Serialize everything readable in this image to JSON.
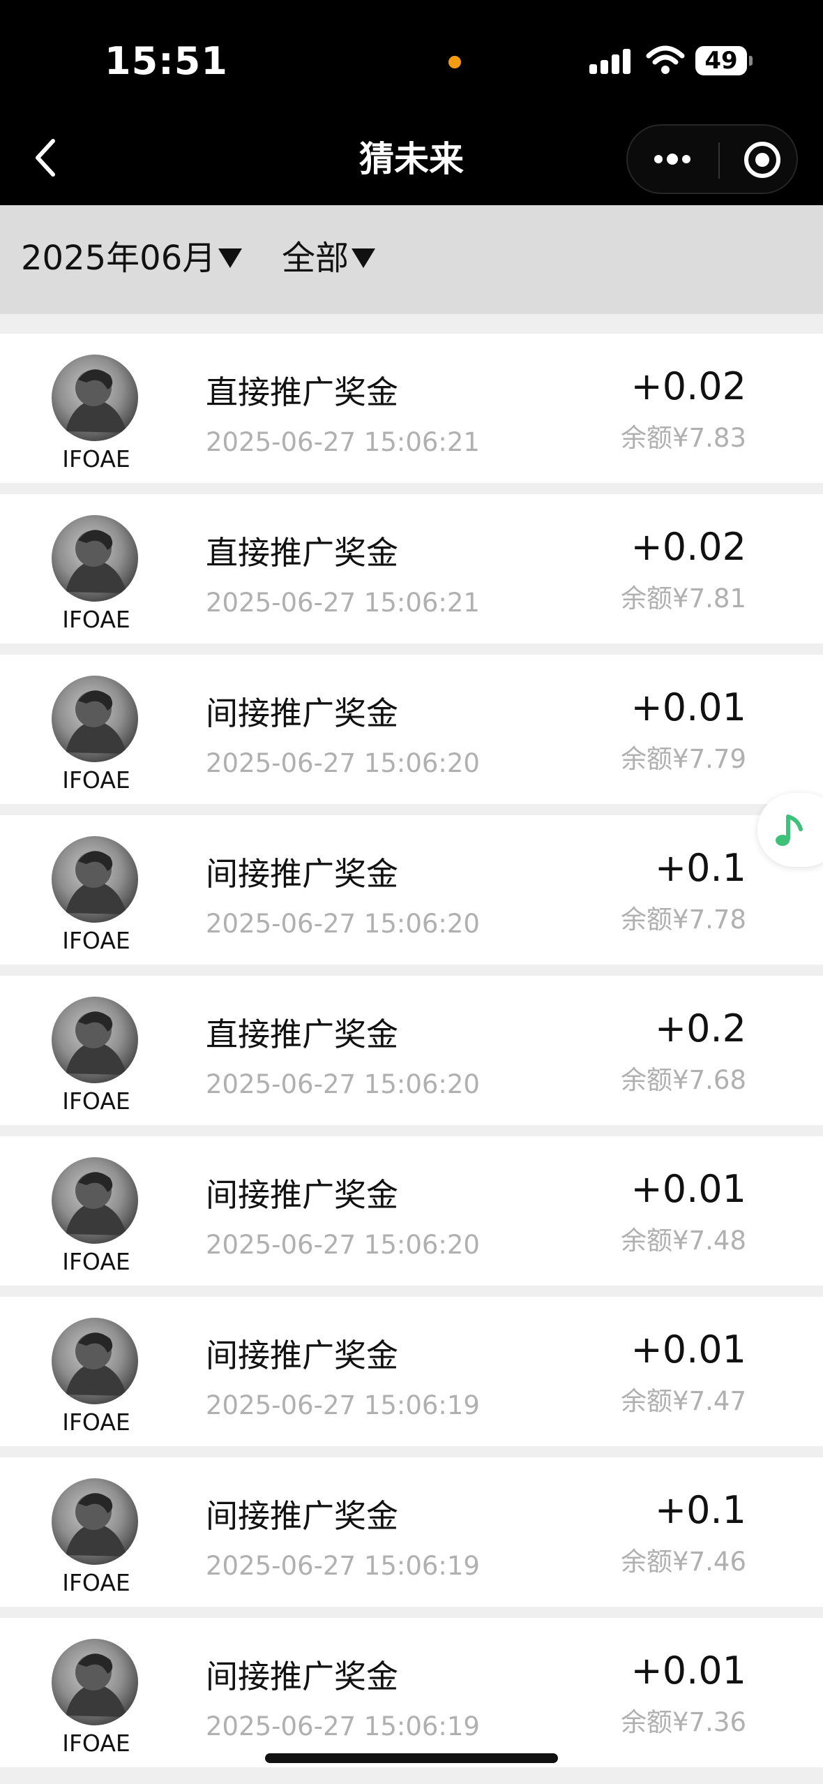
{
  "status_bar": {
    "time": "15:51",
    "battery": "49"
  },
  "nav": {
    "title": "猜未来",
    "icons": [
      "back-icon",
      "more-icon",
      "target-icon"
    ]
  },
  "filters": {
    "month": "2025年06月",
    "category": "全部"
  },
  "records": [
    {
      "user": "IFOAE",
      "title": "直接推广奖金",
      "time": "2025-06-27 15:06:21",
      "amount": "+0.02",
      "balance": "余额¥7.83"
    },
    {
      "user": "IFOAE",
      "title": "直接推广奖金",
      "time": "2025-06-27 15:06:21",
      "amount": "+0.02",
      "balance": "余额¥7.81"
    },
    {
      "user": "IFOAE",
      "title": "间接推广奖金",
      "time": "2025-06-27 15:06:20",
      "amount": "+0.01",
      "balance": "余额¥7.79"
    },
    {
      "user": "IFOAE",
      "title": "间接推广奖金",
      "time": "2025-06-27 15:06:20",
      "amount": "+0.1",
      "balance": "余额¥7.78"
    },
    {
      "user": "IFOAE",
      "title": "直接推广奖金",
      "time": "2025-06-27 15:06:20",
      "amount": "+0.2",
      "balance": "余额¥7.68"
    },
    {
      "user": "IFOAE",
      "title": "间接推广奖金",
      "time": "2025-06-27 15:06:20",
      "amount": "+0.01",
      "balance": "余额¥7.48"
    },
    {
      "user": "IFOAE",
      "title": "间接推广奖金",
      "time": "2025-06-27 15:06:19",
      "amount": "+0.01",
      "balance": "余额¥7.47"
    },
    {
      "user": "IFOAE",
      "title": "间接推广奖金",
      "time": "2025-06-27 15:06:19",
      "amount": "+0.1",
      "balance": "余额¥7.46"
    },
    {
      "user": "IFOAE",
      "title": "间接推广奖金",
      "time": "2025-06-27 15:06:19",
      "amount": "+0.01",
      "balance": "余额¥7.36"
    }
  ],
  "colors": {
    "header_bg": "#000000",
    "filter_bg": "#dcdcdc",
    "list_bg": "#efefef",
    "music_accent": "#3ec27a",
    "status_dot": "#f39c12"
  }
}
